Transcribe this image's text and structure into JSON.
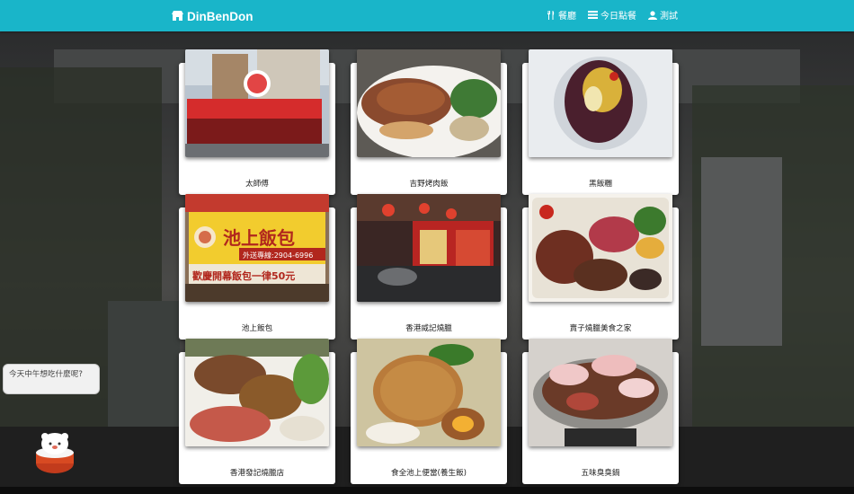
{
  "brand": {
    "name": "DinBenDon",
    "icon": "store-icon"
  },
  "nav": [
    {
      "label": "餐廳",
      "icon": "utensils-icon"
    },
    {
      "label": "今日點餐",
      "icon": "list-icon"
    },
    {
      "label": "測試",
      "icon": "user-icon"
    }
  ],
  "restaurants": [
    {
      "name": "太師傅",
      "photo_label": "storefront photo"
    },
    {
      "name": "吉野烤肉飯",
      "photo_label": "grilled pork rice plate"
    },
    {
      "name": "黑飯糰",
      "photo_label": "black rice ball"
    },
    {
      "name": "池上飯包",
      "photo_label": "池上飯包 shop sign"
    },
    {
      "name": "香港威記燒臘",
      "photo_label": "roast shop interior"
    },
    {
      "name": "賣子燒臘美食之家",
      "photo_label": "roast meat bento"
    },
    {
      "name": "香港發記燒臘店",
      "photo_label": "roast duck rice"
    },
    {
      "name": "食全池上便當(養生飯)",
      "photo_label": "pork chop bento"
    },
    {
      "name": "五味臭臭鍋",
      "photo_label": "hot pot"
    }
  ],
  "photo_texts": {
    "sign_title": "池上飯包",
    "sign_phone": "外送專線:2904-6996",
    "sign_promo": "歡慶開幕飯包一律50元"
  },
  "chat": {
    "prompt": "今天中午想吃什麼呢?"
  },
  "mascot": {
    "icon": "mascot-rice-bowl-icon"
  }
}
